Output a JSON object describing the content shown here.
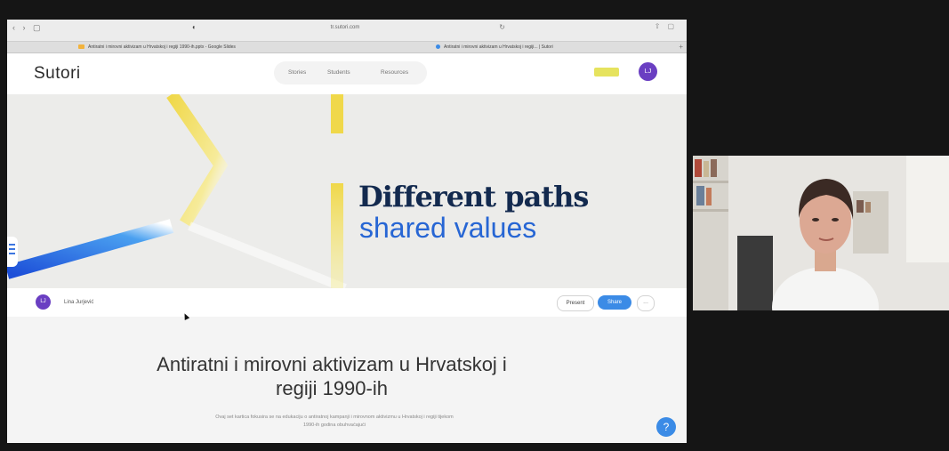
{
  "browser": {
    "nav_buttons": "‹ › ▢",
    "address": "tr.sutori.com",
    "tabs": [
      {
        "label": "Antiratni i mirovni aktivizam u Hrvatskoj i regiji 1990-ih.pptx - Google Slides",
        "favicon_color": "#f2b33d"
      },
      {
        "label": "Antiratni i mirovni aktivizam u Hrvatskoj i regiji... | Sutori",
        "favicon_color": "#3b8be6"
      }
    ]
  },
  "site": {
    "logo": "Sutori",
    "nav": [
      "Stories",
      "Students",
      "Resources"
    ],
    "user_initials": "LJ"
  },
  "hero": {
    "title": "Different paths",
    "subtitle": "shared values"
  },
  "author": {
    "initials": "LJ",
    "name": "Lina Jurjević"
  },
  "actions": {
    "present": "Present",
    "share": "Share",
    "more": "..."
  },
  "story": {
    "title": "Antiratni i mirovni aktivizam u Hrvatskoj i regiji 1990-ih",
    "description": "Ovaj set kartica fokusira se na edukaciju o antiratnoj kampanji i mirovnom aktivizmu u Hrvatskoj i regiji tijekom 1990-ih godina obuhvaćajući"
  },
  "help": "?",
  "colors": {
    "accent_blue": "#3b8be6",
    "title_navy": "#132a4f",
    "subtitle_blue": "#2766d4",
    "star_yellow": "#f0d84a",
    "avatar_purple": "#6a3fc2"
  }
}
